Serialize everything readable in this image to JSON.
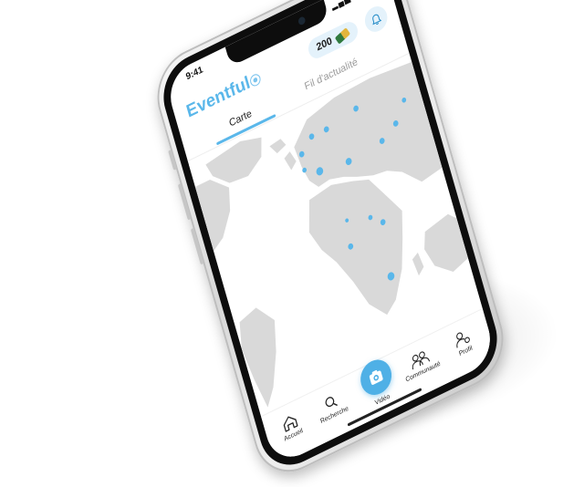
{
  "status_bar": {
    "time": "9:41",
    "icons": "▂▄▆ ≋ ▬"
  },
  "header": {
    "logo_text": "Eventful",
    "points": "200"
  },
  "tabs": [
    {
      "label": "Carte",
      "active": true
    },
    {
      "label": "Fil d'actualité",
      "active": false
    }
  ],
  "map": {
    "marker_color": "#5ab7ea",
    "land_color": "#d9d9d9"
  },
  "bottom_nav": [
    {
      "label": "Accueil",
      "icon": "home-icon"
    },
    {
      "label": "Recherche",
      "icon": "search-icon"
    },
    {
      "label": "Vidéo",
      "icon": "camera-icon"
    },
    {
      "label": "Communauté",
      "icon": "community-icon"
    },
    {
      "label": "Profil",
      "icon": "profile-icon"
    }
  ],
  "colors": {
    "accent": "#5ab7ea",
    "frame": "#e0e0e0",
    "bezel": "#0d0d0d"
  }
}
